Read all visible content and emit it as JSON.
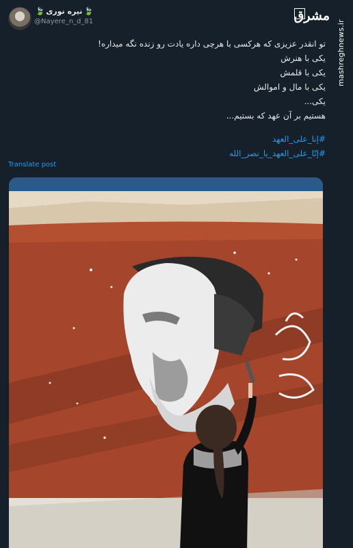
{
  "header": {
    "display_name": "نیره نوری",
    "handle": "@Nayere_n_d_81",
    "leaf_icon": "leaf-emoji"
  },
  "watermark": {
    "logo": "مشرق",
    "site": "mashreghnews.ir"
  },
  "tweet": {
    "lines": [
      "تو انقدر عزیزی که هرکسی با هرچی داره یادت رو زنده نگه میداره!",
      "یکی با هنرش",
      "یکی با قلمش",
      "یکی با مال و اموالش",
      "یکی...",
      "هستیم بر آن عهد که بستیم..."
    ],
    "hashtags": [
      "#إنا_علی_العهد",
      "#إنّا_علی_العهد_یا_نصر_الله"
    ],
    "translate_label": "Translate post"
  },
  "colors": {
    "background": "#15202b",
    "link": "#1d9bf0",
    "wall_red": "#a4452c",
    "wall_top": "#e8dcc7"
  }
}
